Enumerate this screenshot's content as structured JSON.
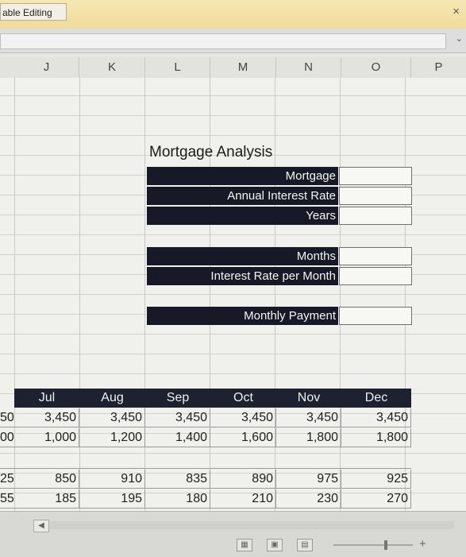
{
  "window": {
    "enable_editing_label": "able Editing",
    "close_glyph": "×",
    "ribbon_caret": "⌄"
  },
  "columns": [
    "J",
    "K",
    "L",
    "M",
    "N",
    "O",
    "P"
  ],
  "analysis": {
    "title": "Mortgage Analysis",
    "labels": [
      "Mortgage",
      "Annual Interest Rate",
      "Years",
      "Months",
      "Interest Rate per Month",
      "Monthly Payment"
    ]
  },
  "months": {
    "headers": [
      "Jul",
      "Aug",
      "Sep",
      "Oct",
      "Nov",
      "Dec"
    ],
    "left_fragments": [
      "50",
      "00",
      "25",
      "55"
    ],
    "rows": [
      [
        "3,450",
        "3,450",
        "3,450",
        "3,450",
        "3,450",
        "3,450"
      ],
      [
        "1,000",
        "1,200",
        "1,400",
        "1,600",
        "1,800",
        "1,800"
      ],
      [
        "850",
        "910",
        "835",
        "890",
        "975",
        "925"
      ],
      [
        "185",
        "195",
        "180",
        "210",
        "230",
        "270"
      ]
    ]
  },
  "statusbar": {
    "scroll_left_glyph": "◀",
    "zoom_plus": "+",
    "view_icons": [
      "normal-view-icon",
      "page-layout-view-icon",
      "page-break-view-icon"
    ]
  }
}
